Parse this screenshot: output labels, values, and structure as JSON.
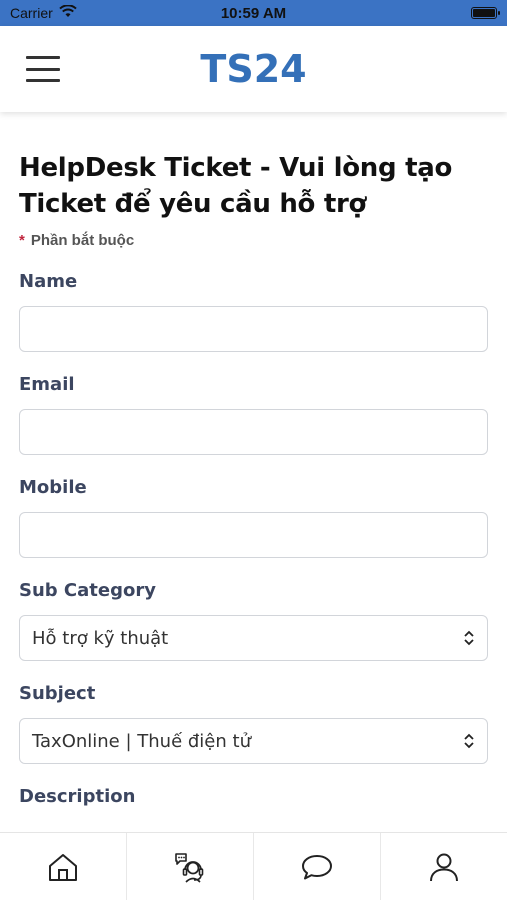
{
  "status_bar": {
    "carrier": "Carrier",
    "time": "10:59 AM",
    "battery_level": 1.0
  },
  "header": {
    "logo": "TS24",
    "menu_icon": "hamburger-icon",
    "brand_color": "#3470b8"
  },
  "form": {
    "title": "HelpDesk Ticket - Vui lòng tạo Ticket để yêu cầu hỗ trợ",
    "required_marker": "*",
    "required_note": "Phần bắt buộc",
    "fields": {
      "name_label": "Name",
      "name_value": "",
      "email_label": "Email",
      "email_value": "",
      "mobile_label": "Mobile",
      "mobile_value": "",
      "subcategory_label": "Sub Category",
      "subcategory_value": "Hỗ trợ kỹ thuật",
      "subject_label": "Subject",
      "subject_value": "TaxOnline | Thuế điện tử",
      "description_label": "Description"
    }
  },
  "tab_bar": {
    "items": [
      {
        "icon": "home-icon"
      },
      {
        "icon": "support-agent-icon"
      },
      {
        "icon": "chat-bubble-icon"
      },
      {
        "icon": "user-profile-icon"
      }
    ]
  }
}
